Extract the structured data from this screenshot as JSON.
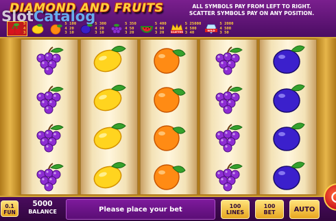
{
  "header": {
    "game_title": "DIAMOND AND FRUITS",
    "rules_line1": "ALL SYMBOLS PAY FROM LEFT TO RIGHT.",
    "rules_line2": "SCATTER SYMBOLS PAY ON ANY POSITION.",
    "watermark_slot": "Slot",
    "watermark_catalog": "Catalog"
  },
  "paytable": [
    {
      "symbol": "cherry-icon",
      "values": [
        "5",
        "4",
        "3"
      ],
      "selected": true
    },
    {
      "symbol": "lemon-icon",
      "values": [
        "",
        "",
        ""
      ]
    },
    {
      "symbol": "orange-icon",
      "values": [
        "5 100",
        "4 20",
        "3 10"
      ]
    },
    {
      "symbol": "plum-icon",
      "values": [
        "5 300",
        "4 20",
        "3 10"
      ]
    },
    {
      "symbol": "grapes-icon",
      "values": [
        "5 350",
        "4 50",
        "3 20"
      ]
    },
    {
      "symbol": "watermelon-icon",
      "values": [
        "5 400",
        "4 60",
        "3 20"
      ]
    },
    {
      "symbol": "scatter-crown-icon",
      "label": "SCATTER",
      "values": [
        "5 25000",
        "4 500",
        "3 40"
      ]
    },
    {
      "symbol": "wild-icon",
      "label": "WILD",
      "values": [
        "5 2000",
        "4 500",
        "3 50"
      ]
    }
  ],
  "reels": [
    [
      "grapes",
      "grapes",
      "grapes",
      "grapes"
    ],
    [
      "lemon",
      "lemon",
      "lemon",
      "lemon"
    ],
    [
      "orange",
      "orange",
      "orange",
      "orange"
    ],
    [
      "grapes",
      "grapes",
      "grapes",
      "grapes"
    ],
    [
      "plum",
      "plum",
      "plum",
      "plum"
    ]
  ],
  "bottom_bar": {
    "coin_value": "0.1",
    "mode_label": "FUN",
    "balance_value": "5000",
    "balance_label": "BALANCE",
    "message": "Please place your bet",
    "lines_value": "100",
    "lines_label": "LINES",
    "bet_value": "100",
    "bet_label": "BET",
    "auto_label": "AUTO"
  },
  "colors": {
    "banner": "#6b1580",
    "gold": "#ffd33a",
    "reel": "#fff6dd",
    "pill": "#f2be3a"
  }
}
